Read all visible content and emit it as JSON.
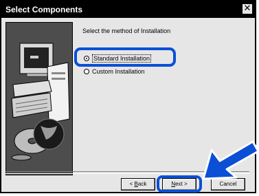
{
  "window": {
    "title": "Select Components",
    "close_label": "✕"
  },
  "main": {
    "prompt": "Select the method of Installation",
    "options": [
      {
        "label": "Standard Installation",
        "selected": true
      },
      {
        "label": "Custom Installation",
        "selected": false
      }
    ]
  },
  "buttons": {
    "back_accel": "B",
    "back_rest": "ack",
    "next_accel": "N",
    "next_rest": "ext >",
    "cancel_label": "Cancel"
  },
  "colors": {
    "highlight": "#0a4fd6",
    "title_bar": "#000000",
    "dialog_bg": "#e6e6e6"
  },
  "icons": [
    "computer-illustration-icon",
    "cd-disc-icon",
    "pointer-arrow-icon",
    "close-icon"
  ]
}
